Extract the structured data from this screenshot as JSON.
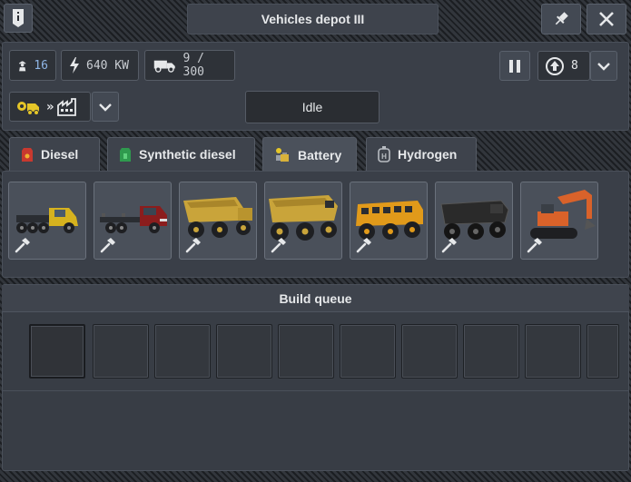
{
  "window": {
    "title": "Vehicles depot III"
  },
  "stats": {
    "workers": "16",
    "power": "640 KW",
    "capacity": "9 / 300"
  },
  "upgrade": {
    "level": "8"
  },
  "status": {
    "label": "Idle"
  },
  "tabs": [
    {
      "label": "Diesel",
      "icon": "fuel-canister-icon",
      "color": "#d0443a"
    },
    {
      "label": "Synthetic diesel",
      "icon": "fuel-canister-icon",
      "color": "#3ba85a"
    },
    {
      "label": "Battery",
      "icon": "battery-icon",
      "color": "#d8b23a",
      "active": true
    },
    {
      "label": "Hydrogen",
      "icon": "hydrogen-icon",
      "color": "#9aa0a8"
    }
  ],
  "vehicles": [
    {
      "name": "truck-tractor-yellow",
      "color": "#d6b21e"
    },
    {
      "name": "truck-flatbed-red",
      "color": "#8b1d1d"
    },
    {
      "name": "dump-truck-yellow",
      "color": "#c9a43a"
    },
    {
      "name": "mining-dump-truck-yellow",
      "color": "#c9a43a"
    },
    {
      "name": "offroad-bus-orange",
      "color": "#e19a1a"
    },
    {
      "name": "mining-truck-black",
      "color": "#2a2a2a"
    },
    {
      "name": "excavator-orange",
      "color": "#d9622a"
    }
  ],
  "build_queue": {
    "title": "Build queue"
  },
  "colors": {
    "accent": "#d6b21e",
    "panel": "#3a3f48",
    "background": "#2a2e34"
  }
}
